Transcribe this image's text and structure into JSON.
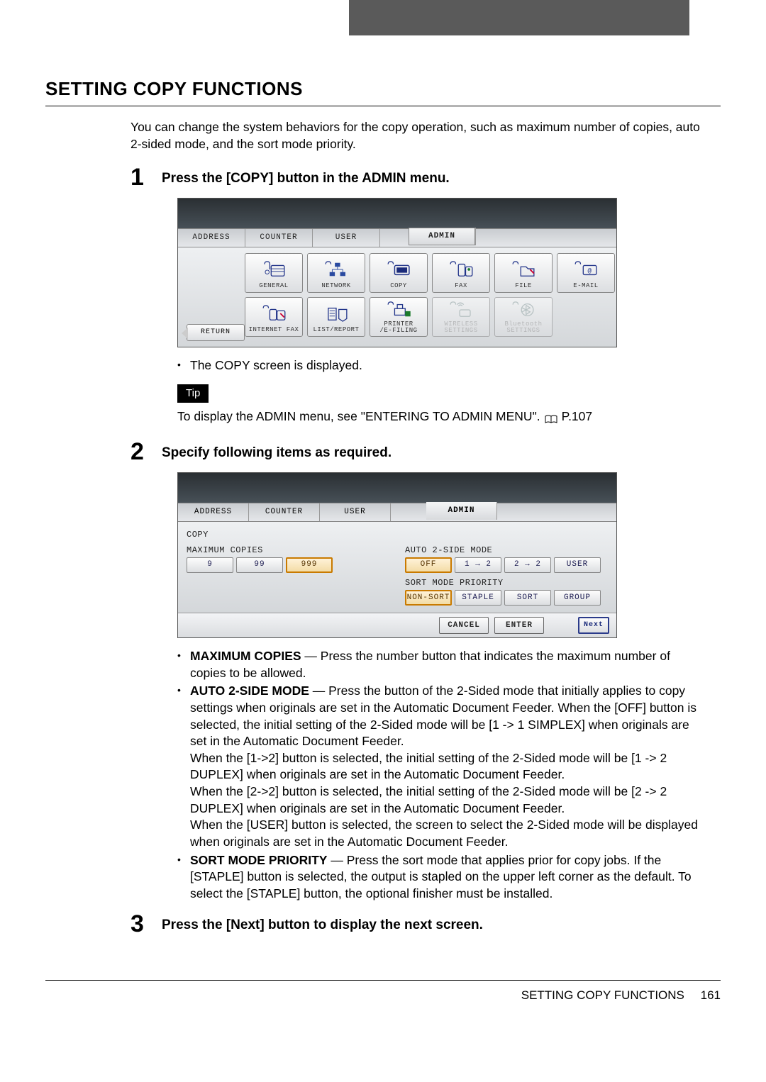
{
  "header_dark_bar": true,
  "title": "SETTING COPY FUNCTIONS",
  "intro": "You can change the system behaviors for the copy operation, such as maximum number of copies, auto 2-sided mode, and the sort mode priority.",
  "steps": {
    "s1": {
      "num": "1",
      "title": "Press the [COPY] button in the ADMIN menu."
    },
    "s2": {
      "num": "2",
      "title": "Specify following items as required."
    },
    "s3": {
      "num": "3",
      "title": "Press the [Next] button to display the next screen."
    }
  },
  "ss1": {
    "tabs": {
      "address": "ADDRESS",
      "counter": "COUNTER",
      "user": "USER",
      "admin": "ADMIN"
    },
    "return": "RETURN",
    "row1": {
      "general": "GENERAL",
      "network": "NETWORK",
      "copy": "COPY",
      "fax": "FAX",
      "file": "FILE",
      "email": "E-MAIL"
    },
    "row2": {
      "ifax": "INTERNET FAX",
      "listrep": "LIST/REPORT",
      "efiling": "PRINTER\n/E-FILING",
      "wireless": "WIRELESS\nSETTINGS",
      "bt": "Bluetooth\nSETTINGS"
    }
  },
  "after_ss1_bullet": "The COPY screen is displayed.",
  "tip_label": "Tip",
  "tip_text_a": "To display the ADMIN menu, see \"ENTERING TO ADMIN MENU\".",
  "tip_text_b": "P.107",
  "ss2": {
    "tabs": {
      "address": "ADDRESS",
      "counter": "COUNTER",
      "user": "USER",
      "admin": "ADMIN"
    },
    "crumb": "COPY",
    "maxcopies_label": "MAXIMUM COPIES",
    "maxcopies": {
      "a": "9",
      "b": "99",
      "c": "999"
    },
    "auto2side_label": "AUTO 2-SIDE MODE",
    "auto2side": {
      "off": "OFF",
      "a": "1 → 2",
      "b": "2 → 2",
      "user": "USER"
    },
    "sortprio_label": "SORT MODE PRIORITY",
    "sortprio": {
      "a": "NON-SORT",
      "b": "STAPLE",
      "c": "SORT",
      "d": "GROUP"
    },
    "footer": {
      "cancel": "CANCEL",
      "enter": "ENTER",
      "next": "Next"
    }
  },
  "desc": {
    "max_t": "MAXIMUM COPIES",
    "max": " — Press the number button that indicates the maximum number of copies to be allowed.",
    "auto_t": "AUTO 2-SIDE MODE",
    "auto": " — Press the button of the 2-Sided mode that initially applies to copy settings when originals are set in the Automatic Document Feeder.  When the [OFF] button is selected, the initial setting of the 2-Sided mode will be [1 -> 1 SIMPLEX] when originals are set in the Automatic Document Feeder.",
    "auto2": "When the [1->2] button is selected, the initial setting of the 2-Sided mode will be [1 -> 2 DUPLEX] when originals are set in the Automatic Document Feeder.",
    "auto3": "When the [2->2] button is selected, the initial setting of the 2-Sided mode will be [2 -> 2 DUPLEX] when originals are set in the Automatic Document Feeder.",
    "auto4": "When the [USER] button is selected, the screen to select the 2-Sided mode will be displayed when originals are set in the Automatic Document Feeder.",
    "sort_t": "SORT MODE PRIORITY",
    "sort": " — Press the sort mode that applies prior for copy jobs.  If the [STAPLE] button is selected, the output is stapled on the upper left corner as the default.  To select the [STAPLE] button, the optional finisher must be installed."
  },
  "footer": {
    "label": "SETTING COPY FUNCTIONS",
    "page": "161"
  }
}
